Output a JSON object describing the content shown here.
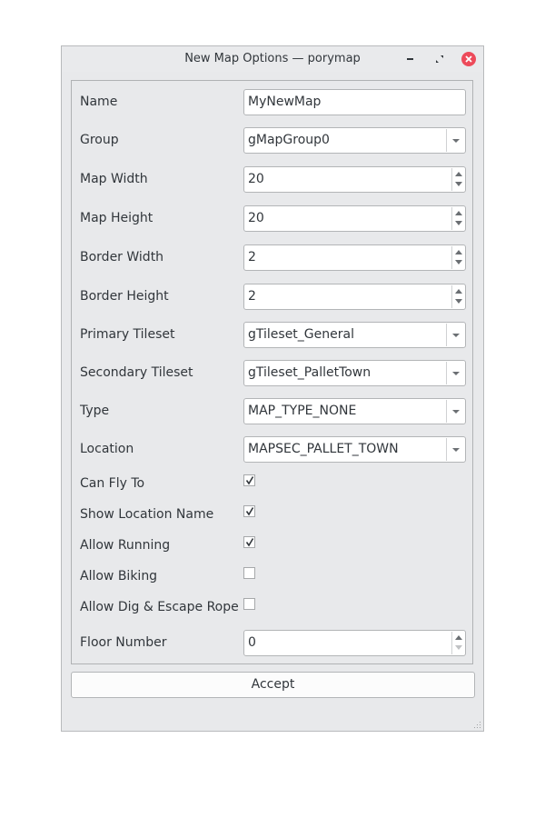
{
  "window": {
    "title": "New Map Options — porymap",
    "buttons": [
      "minimize",
      "maximize",
      "close"
    ]
  },
  "form": {
    "name": {
      "label": "Name",
      "value": "MyNewMap"
    },
    "group": {
      "label": "Group",
      "value": "gMapGroup0"
    },
    "map_width": {
      "label": "Map Width",
      "value": "20"
    },
    "map_height": {
      "label": "Map Height",
      "value": "20"
    },
    "border_width": {
      "label": "Border Width",
      "value": "2"
    },
    "border_height": {
      "label": "Border Height",
      "value": "2"
    },
    "primary_tileset": {
      "label": "Primary Tileset",
      "value": "gTileset_General"
    },
    "secondary_tileset": {
      "label": "Secondary Tileset",
      "value": "gTileset_PalletTown"
    },
    "type": {
      "label": "Type",
      "value": "MAP_TYPE_NONE"
    },
    "location": {
      "label": "Location",
      "value": "MAPSEC_PALLET_TOWN"
    },
    "can_fly_to": {
      "label": "Can Fly To",
      "checked": true
    },
    "show_location_name": {
      "label": "Show Location Name",
      "checked": true
    },
    "allow_running": {
      "label": "Allow Running",
      "checked": true
    },
    "allow_biking": {
      "label": "Allow Biking",
      "checked": false
    },
    "allow_dig_escape": {
      "label": "Allow Dig & Escape Rope",
      "checked": false
    },
    "floor_number": {
      "label": "Floor Number",
      "value": "0"
    }
  },
  "accept_label": "Accept"
}
